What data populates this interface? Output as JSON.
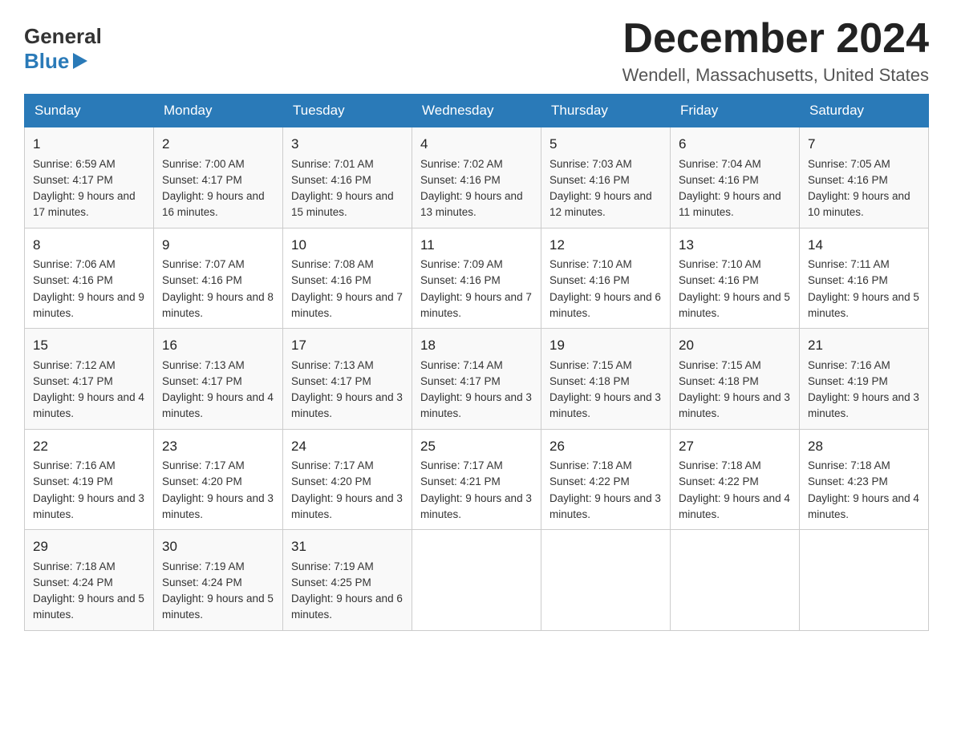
{
  "logo": {
    "line1": "General",
    "line2": "Blue"
  },
  "header": {
    "month": "December 2024",
    "location": "Wendell, Massachusetts, United States"
  },
  "days_of_week": [
    "Sunday",
    "Monday",
    "Tuesday",
    "Wednesday",
    "Thursday",
    "Friday",
    "Saturday"
  ],
  "weeks": [
    [
      {
        "day": "1",
        "sunrise": "6:59 AM",
        "sunset": "4:17 PM",
        "daylight": "9 hours and 17 minutes."
      },
      {
        "day": "2",
        "sunrise": "7:00 AM",
        "sunset": "4:17 PM",
        "daylight": "9 hours and 16 minutes."
      },
      {
        "day": "3",
        "sunrise": "7:01 AM",
        "sunset": "4:16 PM",
        "daylight": "9 hours and 15 minutes."
      },
      {
        "day": "4",
        "sunrise": "7:02 AM",
        "sunset": "4:16 PM",
        "daylight": "9 hours and 13 minutes."
      },
      {
        "day": "5",
        "sunrise": "7:03 AM",
        "sunset": "4:16 PM",
        "daylight": "9 hours and 12 minutes."
      },
      {
        "day": "6",
        "sunrise": "7:04 AM",
        "sunset": "4:16 PM",
        "daylight": "9 hours and 11 minutes."
      },
      {
        "day": "7",
        "sunrise": "7:05 AM",
        "sunset": "4:16 PM",
        "daylight": "9 hours and 10 minutes."
      }
    ],
    [
      {
        "day": "8",
        "sunrise": "7:06 AM",
        "sunset": "4:16 PM",
        "daylight": "9 hours and 9 minutes."
      },
      {
        "day": "9",
        "sunrise": "7:07 AM",
        "sunset": "4:16 PM",
        "daylight": "9 hours and 8 minutes."
      },
      {
        "day": "10",
        "sunrise": "7:08 AM",
        "sunset": "4:16 PM",
        "daylight": "9 hours and 7 minutes."
      },
      {
        "day": "11",
        "sunrise": "7:09 AM",
        "sunset": "4:16 PM",
        "daylight": "9 hours and 7 minutes."
      },
      {
        "day": "12",
        "sunrise": "7:10 AM",
        "sunset": "4:16 PM",
        "daylight": "9 hours and 6 minutes."
      },
      {
        "day": "13",
        "sunrise": "7:10 AM",
        "sunset": "4:16 PM",
        "daylight": "9 hours and 5 minutes."
      },
      {
        "day": "14",
        "sunrise": "7:11 AM",
        "sunset": "4:16 PM",
        "daylight": "9 hours and 5 minutes."
      }
    ],
    [
      {
        "day": "15",
        "sunrise": "7:12 AM",
        "sunset": "4:17 PM",
        "daylight": "9 hours and 4 minutes."
      },
      {
        "day": "16",
        "sunrise": "7:13 AM",
        "sunset": "4:17 PM",
        "daylight": "9 hours and 4 minutes."
      },
      {
        "day": "17",
        "sunrise": "7:13 AM",
        "sunset": "4:17 PM",
        "daylight": "9 hours and 3 minutes."
      },
      {
        "day": "18",
        "sunrise": "7:14 AM",
        "sunset": "4:17 PM",
        "daylight": "9 hours and 3 minutes."
      },
      {
        "day": "19",
        "sunrise": "7:15 AM",
        "sunset": "4:18 PM",
        "daylight": "9 hours and 3 minutes."
      },
      {
        "day": "20",
        "sunrise": "7:15 AM",
        "sunset": "4:18 PM",
        "daylight": "9 hours and 3 minutes."
      },
      {
        "day": "21",
        "sunrise": "7:16 AM",
        "sunset": "4:19 PM",
        "daylight": "9 hours and 3 minutes."
      }
    ],
    [
      {
        "day": "22",
        "sunrise": "7:16 AM",
        "sunset": "4:19 PM",
        "daylight": "9 hours and 3 minutes."
      },
      {
        "day": "23",
        "sunrise": "7:17 AM",
        "sunset": "4:20 PM",
        "daylight": "9 hours and 3 minutes."
      },
      {
        "day": "24",
        "sunrise": "7:17 AM",
        "sunset": "4:20 PM",
        "daylight": "9 hours and 3 minutes."
      },
      {
        "day": "25",
        "sunrise": "7:17 AM",
        "sunset": "4:21 PM",
        "daylight": "9 hours and 3 minutes."
      },
      {
        "day": "26",
        "sunrise": "7:18 AM",
        "sunset": "4:22 PM",
        "daylight": "9 hours and 3 minutes."
      },
      {
        "day": "27",
        "sunrise": "7:18 AM",
        "sunset": "4:22 PM",
        "daylight": "9 hours and 4 minutes."
      },
      {
        "day": "28",
        "sunrise": "7:18 AM",
        "sunset": "4:23 PM",
        "daylight": "9 hours and 4 minutes."
      }
    ],
    [
      {
        "day": "29",
        "sunrise": "7:18 AM",
        "sunset": "4:24 PM",
        "daylight": "9 hours and 5 minutes."
      },
      {
        "day": "30",
        "sunrise": "7:19 AM",
        "sunset": "4:24 PM",
        "daylight": "9 hours and 5 minutes."
      },
      {
        "day": "31",
        "sunrise": "7:19 AM",
        "sunset": "4:25 PM",
        "daylight": "9 hours and 6 minutes."
      },
      null,
      null,
      null,
      null
    ]
  ],
  "labels": {
    "sunrise": "Sunrise:",
    "sunset": "Sunset:",
    "daylight": "Daylight:"
  }
}
